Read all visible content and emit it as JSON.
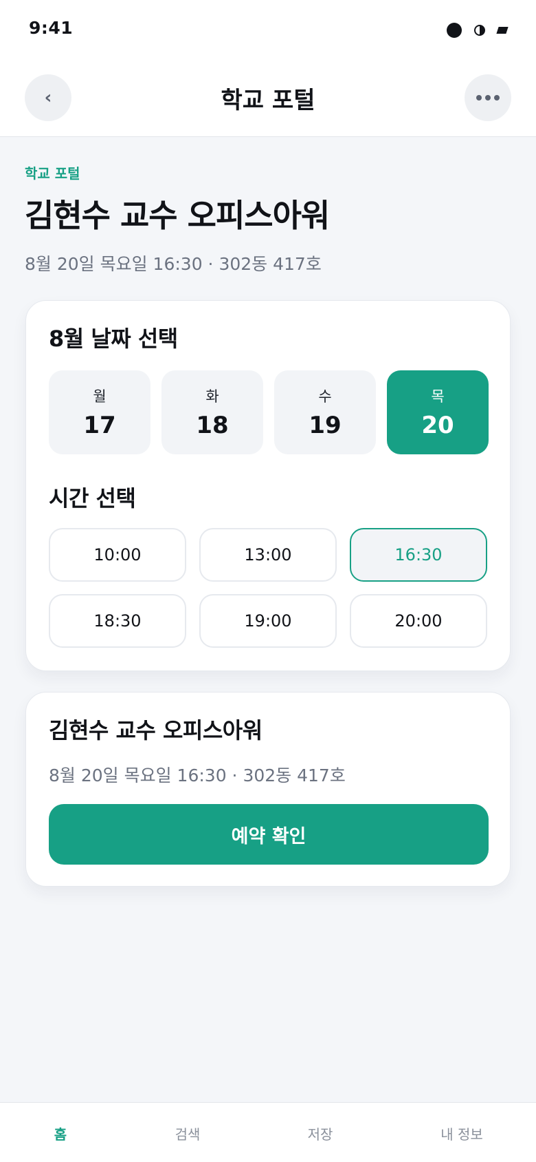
{
  "status_bar": {
    "time": "9:41"
  },
  "header": {
    "title": "학교 포털",
    "back_icon": "chevron-left-icon",
    "back_glyph": "‹",
    "more_icon": "more-horizontal-icon"
  },
  "hero": {
    "eyebrow": "학교 포털",
    "title": "김현수 교수 오피스아워",
    "subtitle": "8월 20일 목요일 16:30 · 302동 417호"
  },
  "date_picker": {
    "title": "8월 날짜 선택",
    "dates": [
      {
        "weekday": "월",
        "day": "17",
        "selected": false
      },
      {
        "weekday": "화",
        "day": "18",
        "selected": false
      },
      {
        "weekday": "수",
        "day": "19",
        "selected": false
      },
      {
        "weekday": "목",
        "day": "20",
        "selected": true
      }
    ]
  },
  "time_picker": {
    "title": "시간 선택",
    "slots": [
      {
        "label": "10:00",
        "selected": false
      },
      {
        "label": "13:00",
        "selected": false
      },
      {
        "label": "16:30",
        "selected": true
      },
      {
        "label": "18:30",
        "selected": false
      },
      {
        "label": "19:00",
        "selected": false
      },
      {
        "label": "20:00",
        "selected": false
      }
    ]
  },
  "summary": {
    "title": "김현수 교수 오피스아워",
    "subtitle": "8월 20일 목요일 16:30 · 302동 417호",
    "confirm_label": "예약 확인"
  },
  "bottom_nav": {
    "items": [
      {
        "label": "홈",
        "active": true
      },
      {
        "label": "검색",
        "active": false
      },
      {
        "label": "저장",
        "active": false
      },
      {
        "label": "내 정보",
        "active": false
      }
    ]
  },
  "colors": {
    "accent": "#17a085",
    "background": "#f4f6f9",
    "muted_text": "#6b7280"
  }
}
